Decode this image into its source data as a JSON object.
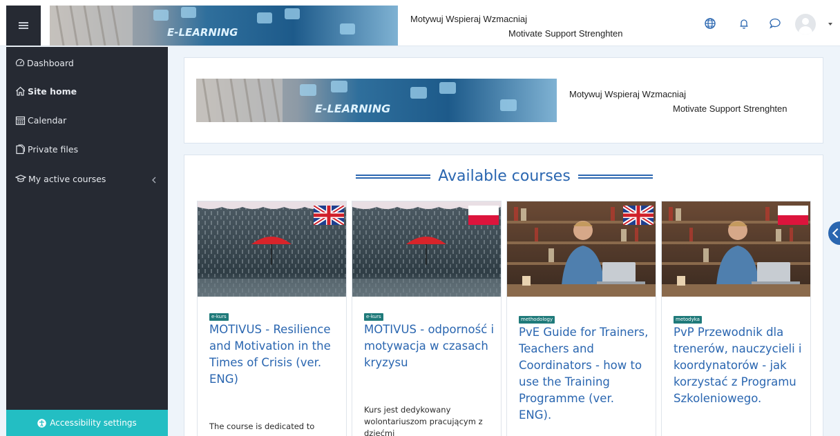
{
  "header": {
    "banner_text": "E-LEARNING",
    "slogan_pl": "Motywuj Wspieraj Wzmacniaj",
    "slogan_en": "Motivate Support Strenghten",
    "icons": [
      "language-icon",
      "bell-icon",
      "messages-icon",
      "user-avatar"
    ]
  },
  "sidebar": {
    "items": [
      {
        "label": "Dashboard",
        "icon": "dashboard-icon"
      },
      {
        "label": "Site home",
        "icon": "home-icon"
      },
      {
        "label": "Calendar",
        "icon": "calendar-icon"
      },
      {
        "label": "Private files",
        "icon": "files-icon"
      },
      {
        "label": "My active courses",
        "icon": "graduation-cap-icon"
      }
    ],
    "accessibility_label": "Accessibility settings"
  },
  "hero": {
    "banner_text": "E-LEARNING",
    "slogan_pl": "Motywuj Wspieraj Wzmacniaj",
    "slogan_en": "Motivate Support Strenghten"
  },
  "courses": {
    "heading": "Available courses",
    "items": [
      {
        "flag": "uk",
        "image": "rain-umbrella",
        "badge": "e-kurs",
        "title": "MOTIVUS - Resilience and Motivation in the Times of Crisis (ver. ENG)",
        "description": "The course is dedicated to"
      },
      {
        "flag": "pl",
        "image": "rain-umbrella",
        "badge": "e-kurs",
        "title": "MOTIVUS - odporność i motywacja w czasach kryzysu",
        "description": "Kurs jest dedykowany wolontariuszom pracującym z dziećmi"
      },
      {
        "flag": "uk",
        "image": "man-laptop-library",
        "badge": "methodology",
        "title": "PvE Guide for Trainers, Teachers and Coordinators - how to use the Training Programme (ver. ENG).",
        "description": ""
      },
      {
        "flag": "pl",
        "image": "man-laptop-library",
        "badge": "metodyka",
        "title": "PvP Przewodnik dla trenerów, nauczycieli i koordynatorów - jak korzystać z Programu Szkoleniowego.",
        "description": ""
      }
    ]
  },
  "colors": {
    "sidebar_bg": "#262a33",
    "accent_blue": "#2a66b0",
    "accessibility_teal": "#23bec3",
    "badge_teal": "#1f7a7a",
    "page_bg": "#eef4fa"
  }
}
